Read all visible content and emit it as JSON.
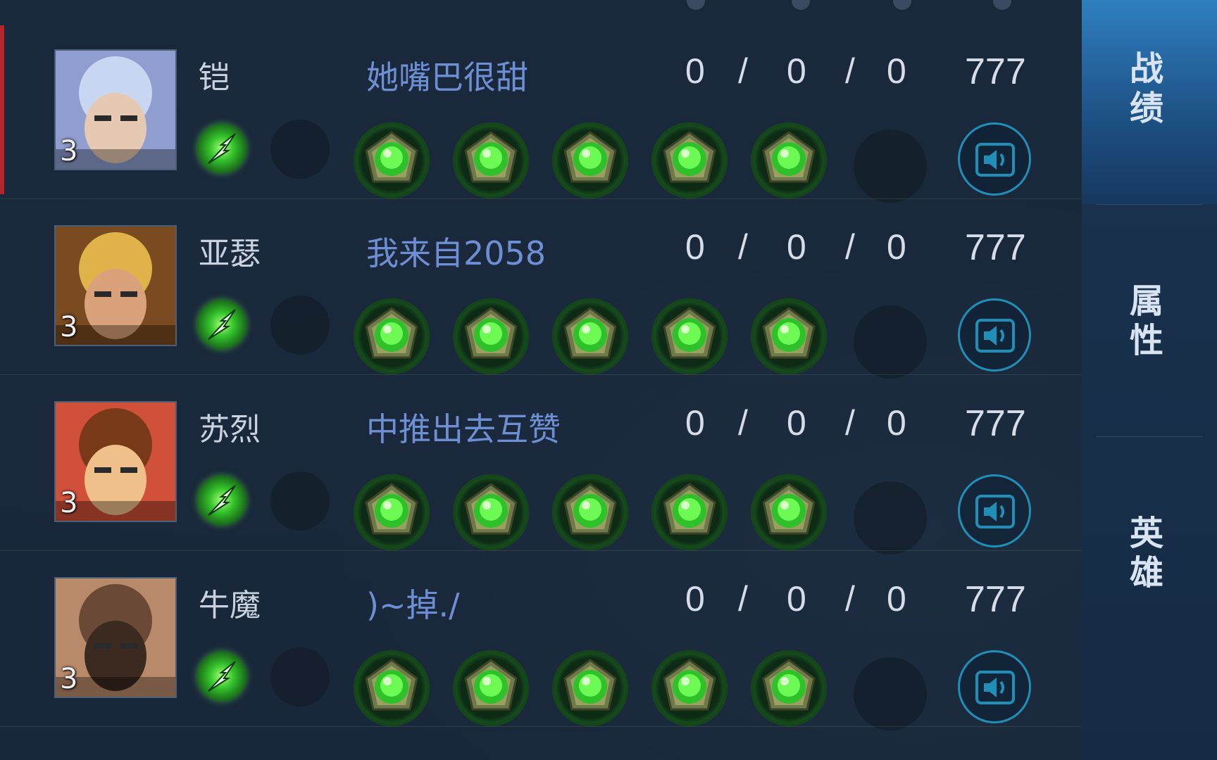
{
  "rows": [
    {
      "hero": "铠",
      "player": "她嘴巴很甜",
      "level": "3",
      "kills": "0",
      "deaths": "0",
      "assists": "0",
      "score": "777",
      "items": [
        "green-gem",
        "green-gem",
        "green-gem",
        "green-gem",
        "green-gem"
      ],
      "active": true
    },
    {
      "hero": "亚瑟",
      "player": "我来自2058",
      "level": "3",
      "kills": "0",
      "deaths": "0",
      "assists": "0",
      "score": "777",
      "items": [
        "green-gem",
        "green-gem",
        "green-gem",
        "green-gem",
        "green-gem"
      ],
      "active": false
    },
    {
      "hero": "苏烈",
      "player": "中推出去互赞",
      "level": "3",
      "kills": "0",
      "deaths": "0",
      "assists": "0",
      "score": "777",
      "items": [
        "green-gem",
        "green-gem",
        "green-gem",
        "green-gem",
        "green-gem"
      ],
      "active": false
    },
    {
      "hero": "牛魔",
      "player": ")~掉./",
      "level": "3",
      "kills": "0",
      "deaths": "0",
      "assists": "0",
      "score": "777",
      "items": [
        "green-gem",
        "green-gem",
        "green-gem",
        "green-gem",
        "green-gem"
      ],
      "active": false
    }
  ],
  "kda_separator": "/",
  "tabs": [
    {
      "label": "战绩",
      "active": true
    },
    {
      "label": "属性",
      "active": false
    },
    {
      "label": "英雄",
      "active": false
    }
  ],
  "colors": {
    "player_name": "#6f8fd4",
    "active_marker": "#b3262b",
    "active_tab": "#2f7fc0",
    "voice_ring": "#1f8fb8",
    "gem": "#33c22a"
  },
  "icons": {
    "spell": "flash-spell-icon",
    "item": "green-gem-icon",
    "voice": "speaker-icon"
  }
}
